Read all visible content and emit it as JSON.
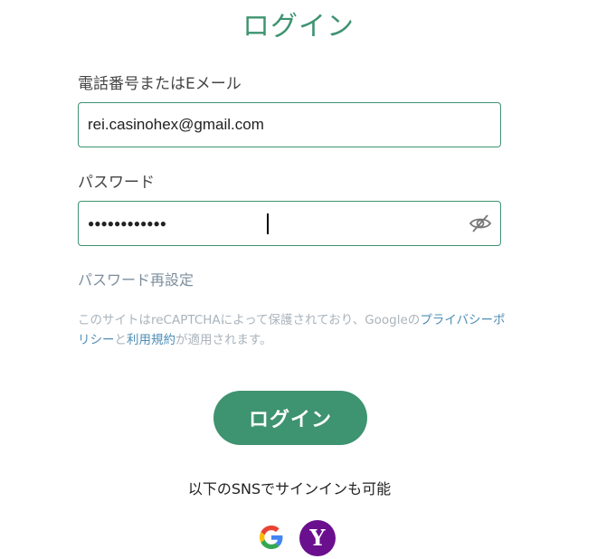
{
  "page_title": "ログイン",
  "form": {
    "email_label": "電話番号またはEメール",
    "email_value": "rei.casinohex@gmail.com",
    "password_label": "パスワード",
    "password_mask": "●●●●●●●●●●●●",
    "password_reset": "パスワード再設定"
  },
  "recaptcha_notice": {
    "text_before": "このサイトはreCAPTCHAによって保護されており、Googleの",
    "privacy_link": "プライバシーポリシー",
    "text_and": "と",
    "terms_link": "利用規約",
    "text_after": "が適用されます。"
  },
  "login_button": "ログイン",
  "sns": {
    "prompt": "以下のSNSでサインインも可能",
    "providers": [
      {
        "name": "google",
        "icon": "google-icon"
      },
      {
        "name": "yahoo",
        "icon": "yahoo-icon",
        "glyph": "Y"
      }
    ]
  },
  "colors": {
    "accent": "#3e9370",
    "link": "#4f8eb6",
    "muted": "#aab4bc",
    "yahoo": "#6a0f8e"
  }
}
